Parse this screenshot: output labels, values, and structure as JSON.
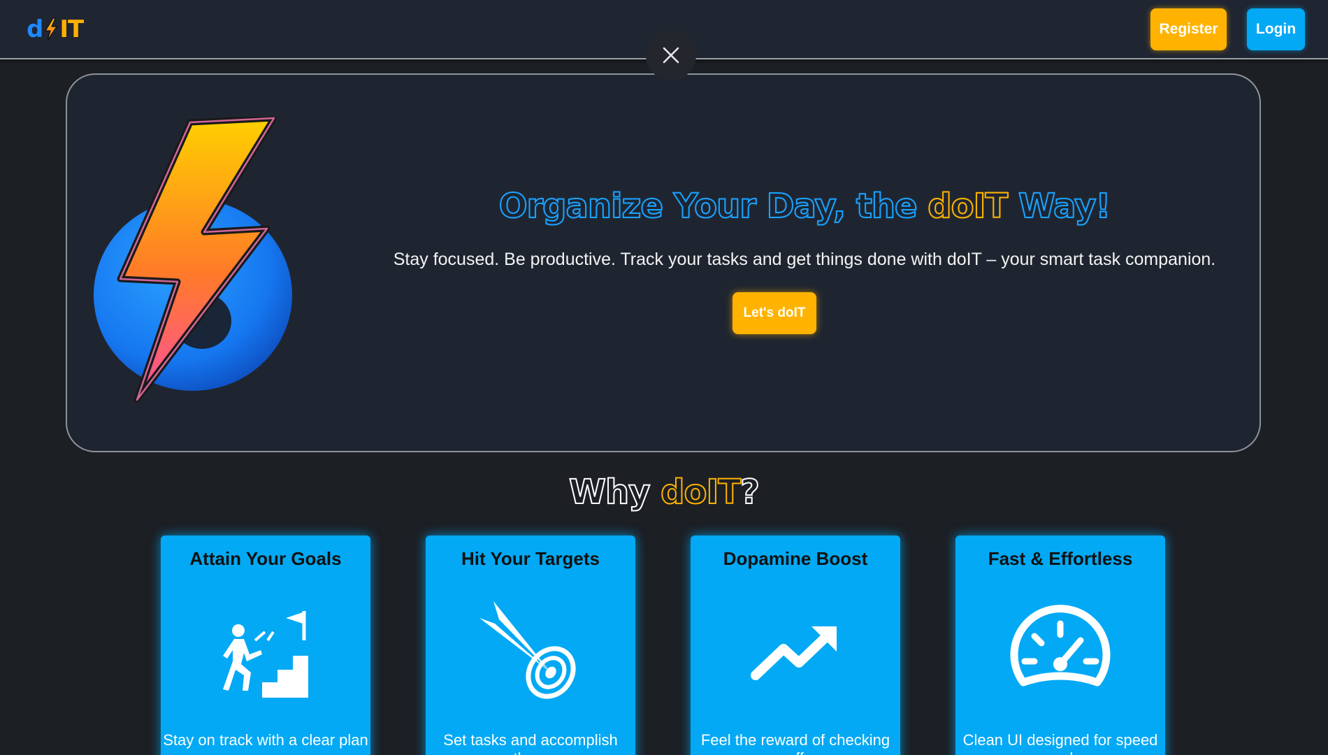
{
  "header": {
    "logo_d": "d",
    "logo_it": "IT",
    "register_label": "Register",
    "login_label": "Login"
  },
  "close_icon": "close-icon",
  "hero": {
    "title_part1": "Organize Your Day, the ",
    "title_brand": "doIT",
    "title_part2": " Way!",
    "subtitle": "Stay focused. Be productive. Track your tasks and get things done with doIT – your smart task companion.",
    "cta_label": "Let's doIT"
  },
  "why": {
    "title_part1": "Why ",
    "title_brand": "doIT",
    "title_part2": "?"
  },
  "features": [
    {
      "title": "Attain Your Goals",
      "icon": "stairs-goal-icon",
      "text": "Stay on track with a clear plan"
    },
    {
      "title": "Hit Your Targets",
      "icon": "target-dart-icon",
      "text": "Set tasks and accomplish them"
    },
    {
      "title": "Dopamine Boost",
      "icon": "trend-up-icon",
      "text": "Feel the reward of checking off"
    },
    {
      "title": "Fast & Effortless",
      "icon": "speedometer-icon",
      "text": "Clean UI designed for speed and"
    }
  ],
  "colors": {
    "brand_blue": "#03a9f4",
    "brand_gold": "#ffb300",
    "background": "#1c1f24",
    "header_bg": "#1f2531"
  }
}
